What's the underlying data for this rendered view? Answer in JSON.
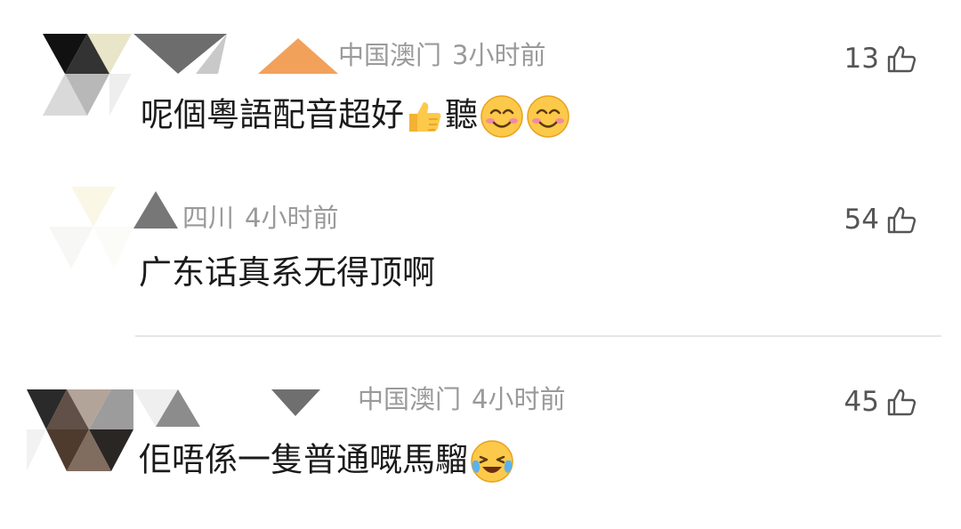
{
  "comments": [
    {
      "region": "中国澳门",
      "time": "3小时前",
      "likes": "13",
      "text": "呢個粵語配音超好",
      "text_tail": "聽",
      "emojis": [
        "thumbs-up-emoji",
        "smiling-face-emoji",
        "smiling-face-emoji"
      ]
    },
    {
      "region": "四川",
      "time": "4小时前",
      "likes": "54",
      "text": "广东话真系无得顶啊"
    },
    {
      "region": "中国澳门",
      "time": "4小时前",
      "likes": "45",
      "text": "佢唔係一隻普通嘅馬騮",
      "emojis": [
        "laughing-crying-emoji"
      ]
    }
  ],
  "icons": {
    "like": "thumbs-up-outline-icon"
  },
  "colors": {
    "meta_text": "#9a9a9a",
    "comment_text": "#1b1b1b",
    "divider": "#e6e6e6"
  }
}
